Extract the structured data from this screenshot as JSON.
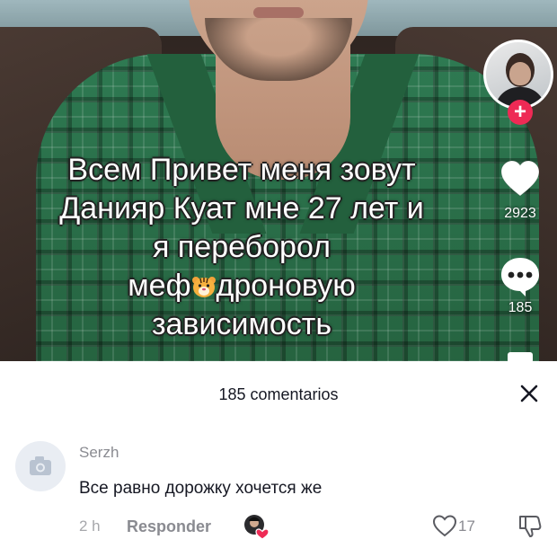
{
  "video": {
    "caption_lines": [
      "Всем Привет меня зовут",
      "Данияр Куат мне 27 лет и",
      "я переборол",
      "меф",
      "дроновую",
      "зависимость"
    ],
    "like_count": "2923",
    "comment_count": "185"
  },
  "comments_panel": {
    "title": "185 comentarios",
    "comments": [
      {
        "username": "Serzh",
        "text": "Все равно дорожку хочется же",
        "time": "2 h",
        "reply_label": "Responder",
        "likes": "17"
      }
    ]
  },
  "icons": {
    "profile": "avatar-image",
    "follow": "plus-icon",
    "like": "heart-icon",
    "comment": "speech-bubble-icon",
    "close": "close-icon",
    "comment_like": "heart-outline-icon",
    "comment_dislike": "thumbs-down-icon",
    "creator_liked": "creator-liked-icon",
    "default_avatar": "camera-icon",
    "emoji": "tiger-face-emoji"
  },
  "colors": {
    "accent": "#ee2a55",
    "text_primary": "#161823",
    "text_secondary": "#8a8b91"
  }
}
